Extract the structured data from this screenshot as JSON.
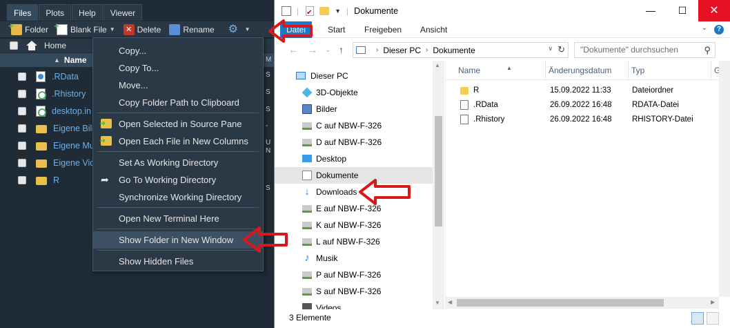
{
  "rstudio": {
    "tabs": [
      "Files",
      "Plots",
      "Help",
      "Viewer"
    ],
    "toolbar": {
      "folder_label": "Folder",
      "blank_file_label": "Blank File",
      "delete_label": "Delete",
      "rename_label": "Rename"
    },
    "path_label": "Home",
    "column_name": "Name",
    "files": [
      {
        "name": ".RData",
        "icon": "rdata-icon"
      },
      {
        "name": ".Rhistory",
        "icon": "rhistory-icon"
      },
      {
        "name": "desktop.in",
        "icon": "ini-icon"
      },
      {
        "name": "Eigene Bild",
        "icon": "folder-icon"
      },
      {
        "name": "Eigene Mu",
        "icon": "folder-icon"
      },
      {
        "name": "Eigene Vid",
        "icon": "folder-icon"
      },
      {
        "name": "R",
        "icon": "folder-icon"
      }
    ],
    "side_col": [
      "M",
      "S",
      "S",
      "S",
      "-",
      "U",
      "N",
      "S"
    ]
  },
  "context_menu": {
    "items": [
      {
        "label": "Copy..."
      },
      {
        "label": "Copy To..."
      },
      {
        "label": "Move..."
      },
      {
        "label": "Copy Folder Path to Clipboard"
      },
      {
        "label": "Open Selected in Source Pane"
      },
      {
        "label": "Open Each File in New Columns"
      },
      {
        "label": "Set As Working Directory"
      },
      {
        "label": "Go To Working Directory"
      },
      {
        "label": "Synchronize Working Directory"
      },
      {
        "label": "Open New Terminal Here"
      },
      {
        "label": "Show Folder in New Window"
      },
      {
        "label": "Show Hidden Files"
      }
    ],
    "highlighted": "Show Folder in New Window"
  },
  "explorer": {
    "title": "Dokumente",
    "ribbon": {
      "file": "Datei",
      "start": "Start",
      "share": "Freigeben",
      "view": "Ansicht"
    },
    "address": {
      "root": "Dieser PC",
      "folder": "Dokumente"
    },
    "search_placeholder": "\"Dokumente\" durchsuchen",
    "nav": [
      {
        "label": "Dieser PC",
        "icon": "pc-icon"
      },
      {
        "label": "3D-Objekte",
        "icon": "3d-objects-icon"
      },
      {
        "label": "Bilder",
        "icon": "pictures-icon"
      },
      {
        "label": "C auf NBW-F-326",
        "icon": "network-drive-icon"
      },
      {
        "label": "D auf NBW-F-326",
        "icon": "network-drive-icon"
      },
      {
        "label": "Desktop",
        "icon": "desktop-icon"
      },
      {
        "label": "Dokumente",
        "icon": "documents-icon"
      },
      {
        "label": "Downloads",
        "icon": "downloads-icon"
      },
      {
        "label": "E auf NBW-F-326",
        "icon": "network-drive-icon"
      },
      {
        "label": "K auf NBW-F-326",
        "icon": "network-drive-icon"
      },
      {
        "label": "L auf NBW-F-326",
        "icon": "network-drive-icon"
      },
      {
        "label": "Musik",
        "icon": "music-icon"
      },
      {
        "label": "P auf NBW-F-326",
        "icon": "network-drive-icon"
      },
      {
        "label": "S auf NBW-F-326",
        "icon": "network-drive-icon"
      },
      {
        "label": "Videos",
        "icon": "videos-icon"
      }
    ],
    "selected_nav": "Dokumente",
    "columns": [
      "Name",
      "Änderungsdatum",
      "Typ",
      "G"
    ],
    "rows": [
      {
        "name": "R",
        "date": "15.09.2022 11:33",
        "type": "Dateiordner",
        "icon": "folder-icon"
      },
      {
        "name": ".RData",
        "date": "26.09.2022 16:48",
        "type": "RDATA-Datei",
        "icon": "file-icon"
      },
      {
        "name": ".Rhistory",
        "date": "26.09.2022 16:48",
        "type": "RHISTORY-Datei",
        "icon": "file-icon"
      }
    ],
    "status": "3 Elemente"
  },
  "colors": {
    "accent_red": "#d7191c",
    "explorer_blue": "#1979ca",
    "rstudio_bg": "#1f2b36"
  }
}
